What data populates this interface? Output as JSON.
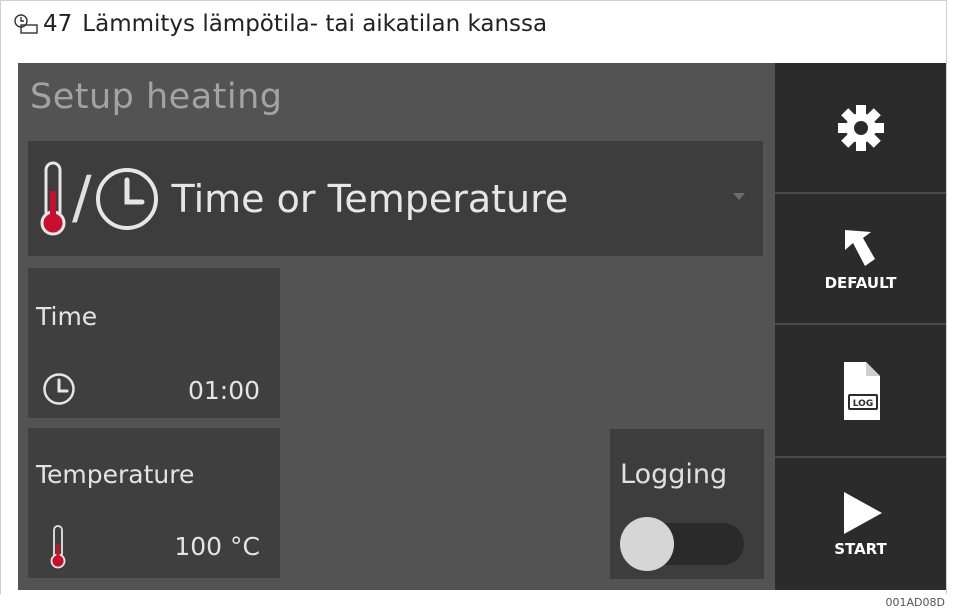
{
  "caption": {
    "figure_number": "47",
    "text": "Lämmitys lämpötila- tai aikatilan kanssa"
  },
  "image_code": "001AD08D",
  "screen": {
    "title": "Setup heating",
    "mode": {
      "separator": "/",
      "label": "Time or Temperature"
    },
    "time": {
      "label": "Time",
      "value": "01:00"
    },
    "temperature": {
      "label": "Temperature",
      "value": "100 °C"
    },
    "logging": {
      "label": "Logging",
      "enabled": false
    },
    "sidebar": {
      "settings_label": "",
      "default_label": "DEFAULT",
      "log_label": "LOG",
      "start_label": "START"
    }
  },
  "colors": {
    "screen_bg": "#535353",
    "panel_bg": "#3f3f3f",
    "sidebar_bg": "#2b2b2b",
    "thermometer_red": "#c8102e"
  },
  "icons": [
    "figure-icon",
    "thermometer-icon",
    "clock-icon",
    "chevron-down-icon",
    "gear-icon",
    "undo-arrow-icon",
    "log-file-icon",
    "play-icon"
  ]
}
